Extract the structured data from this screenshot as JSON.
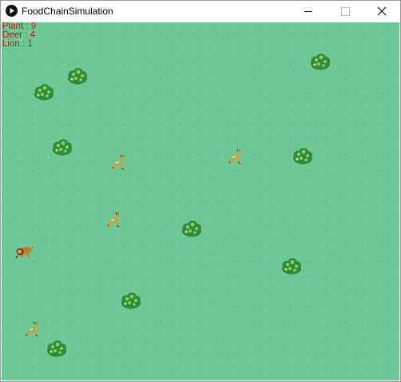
{
  "window": {
    "title": "FoodChainSimulation"
  },
  "counters": [
    {
      "label": "Plant",
      "value": "9"
    },
    {
      "label": "Deer",
      "value": "4"
    },
    {
      "label": "Lion",
      "value": "1"
    }
  ],
  "counter_lines": [
    "Plant : 9",
    "Deer : 4",
    "Lion : 1"
  ],
  "colors": {
    "grass": "#6dc895",
    "counter_text": "#b31b1b",
    "bush_dark": "#2f8a3c",
    "bush_light": "#8ad05a",
    "deer": "#d99a3a",
    "lion": "#c8762a"
  },
  "icons": {
    "app": "processing-play-icon",
    "minimize": "minimize-icon",
    "maximize": "maximize-icon",
    "close": "close-icon"
  }
}
